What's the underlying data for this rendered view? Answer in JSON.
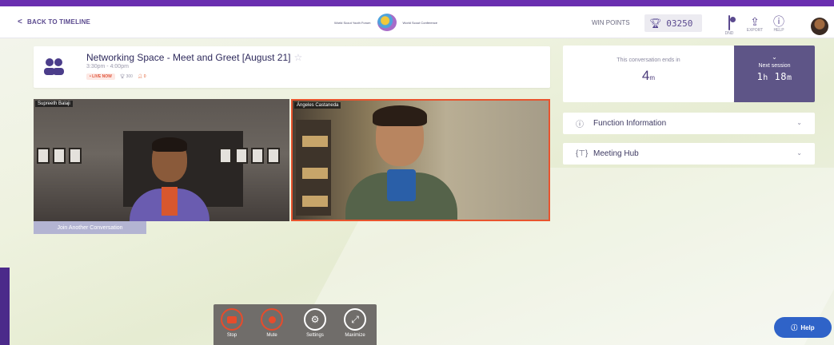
{
  "header": {
    "back_label": "BACK TO TIMELINE",
    "logo_text_left": "World Scout Youth Forum",
    "logo_text_right": "World Scout Conference",
    "winpoints_label": "WIN POINTS",
    "winpoints_value": "03250",
    "icons": [
      {
        "name": "dnd-toggle",
        "label": "DND"
      },
      {
        "name": "export-icon",
        "label": "EXPORT"
      },
      {
        "name": "help-icon",
        "label": "HELP"
      }
    ]
  },
  "session": {
    "title": "Networking Space - Meet and Greet [August 21]",
    "time": "3:30pm - 4:00pm",
    "live_badge": "• LIVE NOW",
    "metric_1": "300",
    "metric_2": "0"
  },
  "conversation": {
    "label": "This conversation ends in",
    "value": "4",
    "unit": "m"
  },
  "next_session": {
    "label": "Next session",
    "hours": "1",
    "minutes": "18"
  },
  "accordions": [
    {
      "label": "Function Information",
      "icon": "info-icon"
    },
    {
      "label": "Meeting Hub",
      "icon": "meeting-hub-icon"
    }
  ],
  "videos": [
    {
      "name": "Supreeth Balaji"
    },
    {
      "name": "Ángeles Castaneda"
    }
  ],
  "join_label": "Join Another Conversation",
  "controls": [
    {
      "label": "Stop",
      "icon": "camera-icon"
    },
    {
      "label": "Mute",
      "icon": "mic-icon"
    },
    {
      "label": "Settings",
      "icon": "gear-icon"
    },
    {
      "label": "Maximize",
      "icon": "maximize-icon"
    }
  ],
  "help_button": "Help",
  "colors": {
    "brand_purple": "#6a2fb0",
    "accent_red": "#e8542e",
    "help_blue": "#2f63c8",
    "panel_purple": "#5e5587"
  }
}
